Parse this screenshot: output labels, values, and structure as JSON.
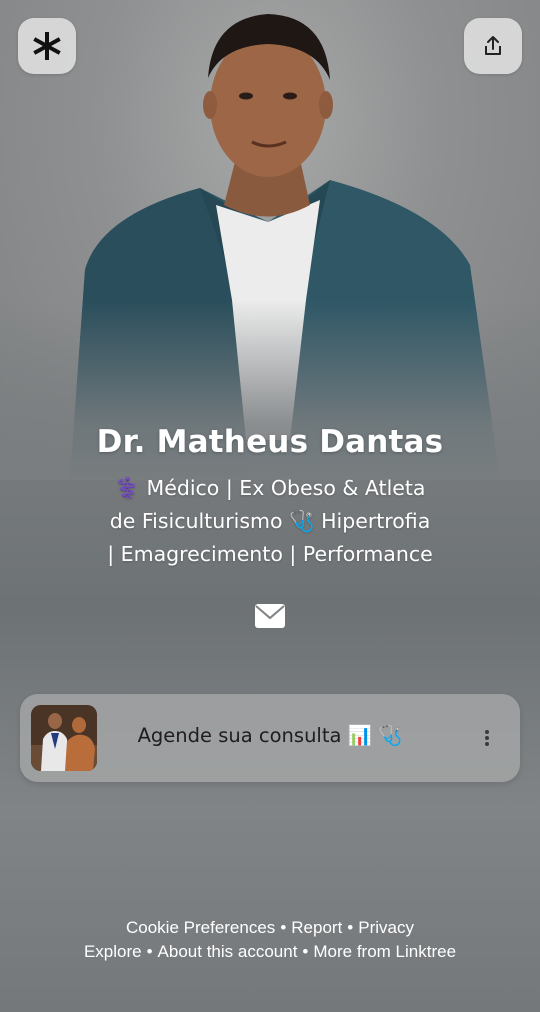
{
  "top_bar": {
    "linktree_icon": "linktree-asterisk-icon",
    "share_icon": "share-icon"
  },
  "profile": {
    "name": "Dr. Matheus Dantas",
    "bio_line1": "⚕️ Médico | Ex Obeso & Atleta",
    "bio_line2": "de Fisiculturismo 🩺 Hipertrofia",
    "bio_line3": "| Emagrecimento | Performance",
    "email_icon": "mail-icon"
  },
  "links": [
    {
      "label": "Agende sua consulta 📊 🩺",
      "thumb": "profile-thumbnail",
      "menu_icon": "more-vertical-icon"
    }
  ],
  "footer": {
    "row1": [
      "Cookie Preferences",
      "Report",
      "Privacy"
    ],
    "row2": [
      "Explore",
      "About this account",
      "More from Linktree"
    ],
    "separator": "•"
  }
}
